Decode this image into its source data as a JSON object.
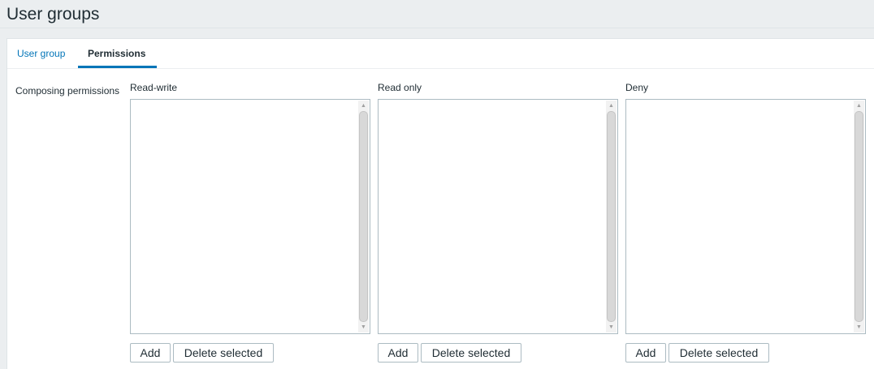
{
  "page": {
    "title": "User groups"
  },
  "tabs": [
    {
      "label": "User group",
      "active": false
    },
    {
      "label": "Permissions",
      "active": true
    }
  ],
  "form": {
    "field_label": "Composing permissions",
    "columns": [
      {
        "label": "Read-write",
        "items": [],
        "add_label": "Add",
        "delete_label": "Delete selected"
      },
      {
        "label": "Read only",
        "items": [],
        "add_label": "Add",
        "delete_label": "Delete selected"
      },
      {
        "label": "Deny",
        "items": [],
        "add_label": "Add",
        "delete_label": "Delete selected"
      }
    ]
  },
  "icons": {
    "scroll_up": "scroll-up-arrow-icon",
    "scroll_down": "scroll-down-arrow-icon"
  },
  "colors": {
    "link": "#0275b8",
    "active_tab_underline": "#0275b8",
    "page_background": "#ebeef0",
    "panel_background": "#ffffff",
    "border": "#acbbc2"
  }
}
